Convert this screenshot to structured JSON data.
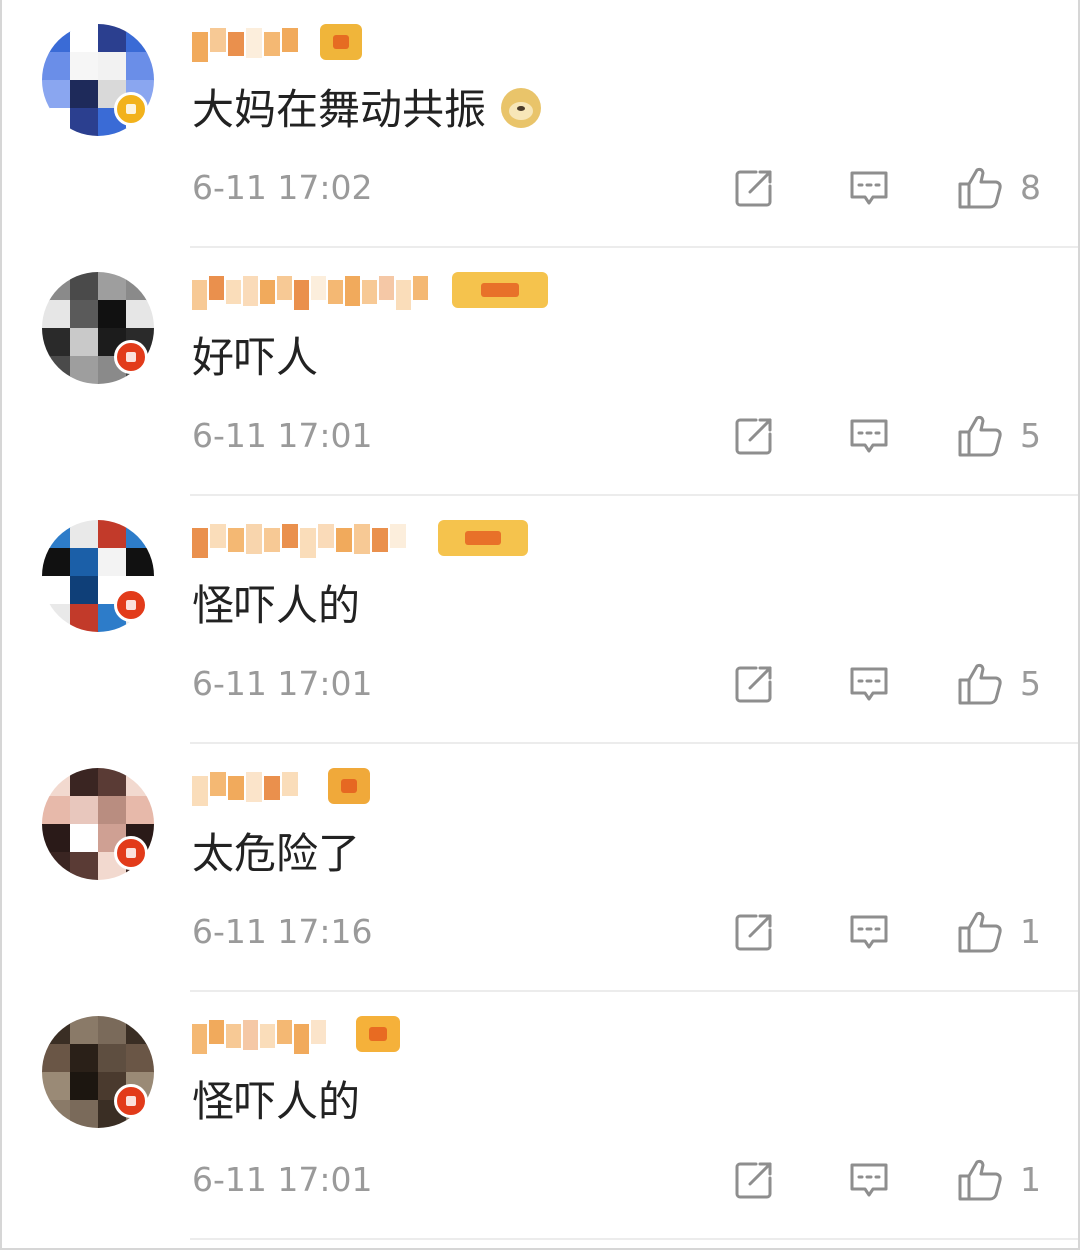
{
  "comments": [
    {
      "text": "大妈在舞动共振",
      "emoji": "doge-emoji",
      "time": "6-11 17:02",
      "likes": "8",
      "avatar_colors": [
        "#3a6bd6",
        "#f2f2f2",
        "#1e2a5a",
        "#ffffff",
        "#6a8ee8",
        "#d9d9d9",
        "#2b3f8f",
        "#f6f6f6",
        "#8aa6f0"
      ],
      "badge_color": "#f2b21c",
      "rank_badge_color": "#f0b53a"
    },
    {
      "text": "好吓人",
      "time": "6-11 17:01",
      "likes": "5",
      "avatar_colors": [
        "#2a2a2a",
        "#8a8a8a",
        "#111111",
        "#c9c9c9",
        "#4a4a4a",
        "#e6e6e6",
        "#1c1c1c",
        "#9e9e9e",
        "#5a5a5a"
      ],
      "badge_color": "#e23b1a",
      "rank_badge_color": "#f5c34d"
    },
    {
      "text": "怪吓人的",
      "time": "6-11 17:01",
      "likes": "5",
      "avatar_colors": [
        "#1b5fa8",
        "#ffffff",
        "#2d7cc9",
        "#f3f3f3",
        "#0f3f78",
        "#e9e9e9",
        "#111111",
        "#ffffff",
        "#c23a2a"
      ],
      "badge_color": "#e23b1a",
      "rank_badge_color": "#f5c34d"
    },
    {
      "text": "太危险了",
      "time": "6-11 17:16",
      "likes": "1",
      "avatar_colors": [
        "#5a3b35",
        "#e8c7bd",
        "#2a1a18",
        "#f2d9cf",
        "#b98d80",
        "#ffffff",
        "#3a2522",
        "#e7b9aa",
        "#cfa093"
      ],
      "badge_color": "#e23b1a",
      "rank_badge_color": "#f0a93a"
    },
    {
      "text": "怪吓人的",
      "time": "6-11 17:01",
      "likes": "1",
      "avatar_colors": [
        "#4a3a2e",
        "#7a6a5a",
        "#2a2018",
        "#9a8a76",
        "#3a2e24",
        "#5e4e40",
        "#1c1610",
        "#8a7a68",
        "#6a5646"
      ],
      "badge_color": "#e23b1a",
      "rank_badge_color": "#f5b13a"
    }
  ],
  "colors": {
    "username": "#f0a14a",
    "text": "#222222",
    "meta": "#9a9a9a",
    "divider": "#ececec"
  },
  "icons": {
    "share": "share-icon",
    "reply": "comment-icon",
    "like": "thumbs-up-icon"
  }
}
